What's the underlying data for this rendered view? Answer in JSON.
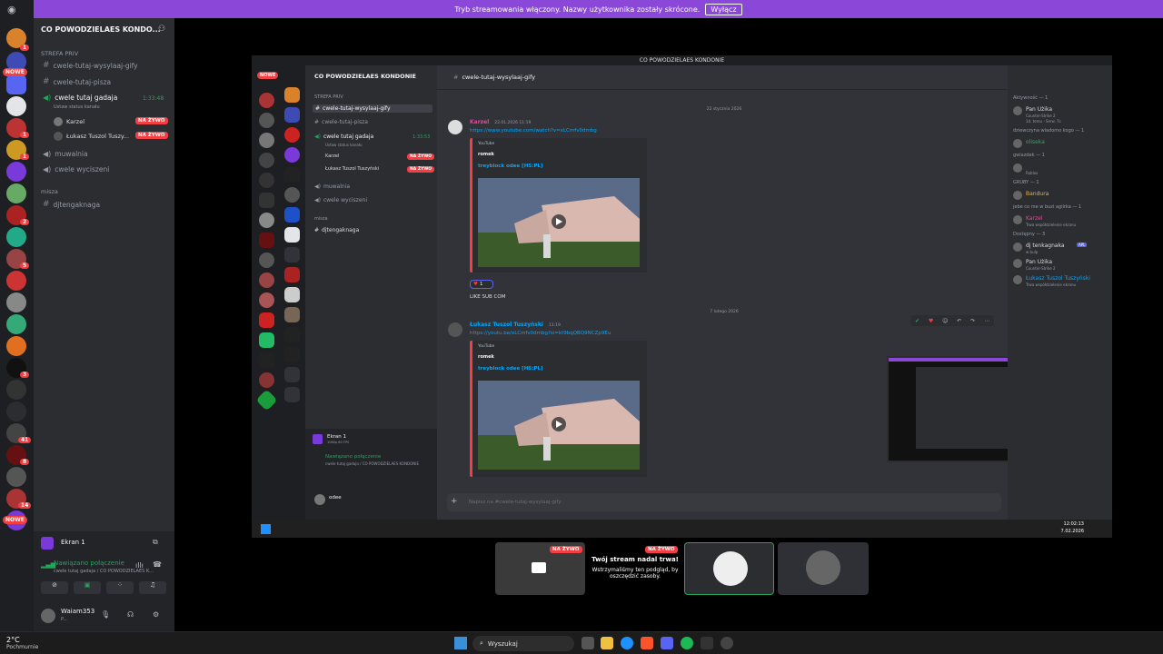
{
  "banner": {
    "text": "Tryb streamowania włączony. Nazwy użytkownika zostały skrócone.",
    "button": "Wyłącz"
  },
  "outer": {
    "server_name": "CO POWODZIELAES KONDO...",
    "rail_new_label": "NOWE",
    "rail_new_label_bottom": "NOWE",
    "rail_badges": [
      "1",
      "1",
      "1",
      "2",
      "1",
      "5",
      "1",
      "8",
      "1",
      "3",
      "41",
      "8",
      "14",
      "1"
    ],
    "categories": {
      "strefa": "STREFA PRIV",
      "misc": "misza"
    },
    "channels": [
      {
        "name": "cwele-tutaj-wysylaaj-gify"
      },
      {
        "name": "cwele-tutaj-pisza"
      }
    ],
    "voice_active": {
      "name": "cwele tutaj gadaja",
      "time": "1:33:48",
      "status": "Ustaw status kanału"
    },
    "voice_users": [
      {
        "name": "Karzel",
        "badge": "NA ŻYWO"
      },
      {
        "name": "Łukasz Tuszol Tuszy...",
        "badge": "NA ŻYWO"
      }
    ],
    "voice_channels": [
      "muwalnia",
      "cwele wyciszeni"
    ],
    "misc_channel": "djtengaknaga",
    "panel": {
      "screen": "Ekran 1",
      "connected": "Nawiązano połączenie",
      "connected_sub": "cwele tutaj gadaja / CO POWODZIELAES K...",
      "username": "Waiam353",
      "user_status": "P..."
    }
  },
  "inner": {
    "window_title": "CO POWODZIELAES KONDONIE",
    "server_name": "CO POWODZIELAES KONDONIE",
    "rail_new": "NOWE",
    "category": "STREFA PRIV",
    "channels": [
      "cwele-tutaj-wysylaaj-gify",
      "cwele-tutaj-pisza"
    ],
    "voice_active": {
      "name": "cwele tutaj gadaja",
      "time": "1:33:53",
      "status": "Ustaw status kanału"
    },
    "voice_users": [
      {
        "name": "Karzel",
        "badge": "NA ŻYWO"
      },
      {
        "name": "Łukasz Tuszol Tuszyński",
        "badge": "NA ŻYWO"
      }
    ],
    "voice_channels": [
      "muwalnia",
      "cwele wyciszeni"
    ],
    "misc_cat": "misza",
    "misc_channel": "djtengaknaga",
    "panel": {
      "screen": "Ekran 1",
      "screen_sub": "1080p 60 FPS",
      "connected": "Nawiązano połączenie",
      "connected_sub": "cwele tutaj gadaja / CO POWODZIELAES KONDONIE",
      "username": "odee"
    },
    "header_channel": "cwele-tutaj-wysylaaj-gify",
    "search_placeholder": "Wyszukaj CO POWODZIELAES K...",
    "date1": "22 stycznia 2026",
    "msg1": {
      "author": "Karzel",
      "time": "22.01.2026 11:19",
      "link": "https://www.youtube.com/watch?v=xLCmfv0dmbg",
      "provider": "YouTube",
      "channel": "romek",
      "title": "treyblock odee [HS:PL]",
      "reaction_count": "1",
      "text": "LIKE SUB COM"
    },
    "date2": "7 lutego 2026",
    "msg2": {
      "author": "Łukasz Tuszol Tuszyński",
      "time": "11:19",
      "link": "https://youtu.be/xLCmfv0dmbg?si=kt9bqQBQ9NCZp9Eu",
      "provider": "YouTube",
      "channel": "romek",
      "title": "treyblock odee [HS:PL]"
    },
    "composer_placeholder": "Napisz na #cwele-tutaj-wysylaaj-gify",
    "members": [
      {
        "cat": "Aktywność — 1",
        "name": "Pan Użika",
        "sub": "Counter-Strike 2",
        "sub2": "1d. temu · Serw. 7s",
        "color": "#dbdee1"
      },
      {
        "cat": "dziewczyna wladomo kogo — 1",
        "name": "oliseka",
        "sub": "",
        "sub2": "",
        "color": "#3ba55c"
      },
      {
        "cat": "gwiazdek — 1",
        "name": "",
        "sub": "Roblox",
        "sub2": "",
        "color": "#dbdee1"
      },
      {
        "cat": "GRUBY — 1",
        "name": "Bandura",
        "sub": "",
        "sub2": "",
        "color": "#f0b232"
      },
      {
        "cat": "jebe co me w buzi agiirka — 1",
        "name": "Karzel",
        "sub": "Trwa współdzielenie ekranu",
        "sub2": "",
        "color": "#eb459e"
      },
      {
        "cat": "Dostępny — 3",
        "name": "dj tenkagnaka",
        "sub": "w bulp",
        "sub2": "",
        "color": "#dbdee1"
      },
      {
        "cat": "",
        "name": "Pan Użika",
        "sub": "Counter-Strike 2",
        "sub2": "",
        "color": "#dbdee1"
      },
      {
        "cat": "",
        "name": "Łukasz Tuszol Tuszyński",
        "sub": "Trwa współdzielenie ekranu",
        "sub2": "",
        "color": "#00a8fc"
      }
    ],
    "member_badge": "APL",
    "clock": {
      "time": "12:02:13",
      "date": "7.02.2026"
    }
  },
  "stream": {
    "live_badge": "NA ŻYWO",
    "paused_title": "Twój stream nadal trwa!",
    "paused_body": "Wstrzymaliśmy ten podgląd, by oszczędzić zasoby.",
    "live_badge2": "NA ŻYWO"
  },
  "taskbar": {
    "weather_temp": "2°C",
    "weather_desc": "Pochmurnie",
    "search": "Wyszukaj"
  },
  "colors": {
    "blurple": "#5865f2",
    "live_red": "#f23f43",
    "link_blue": "#00a8fc",
    "banner_purple": "#8a47d8",
    "online_green": "#23a55a"
  }
}
